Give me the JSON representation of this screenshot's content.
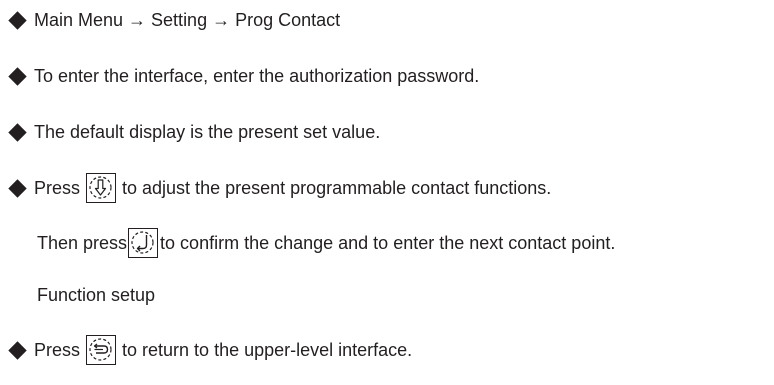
{
  "lines": {
    "nav_path": "Main Menu → Setting → Prog Contact",
    "authorization": "To enter the interface, enter the authorization password.",
    "default_display": "The default display is the present set value.",
    "press_adjust_prefix": "Press",
    "press_adjust_suffix": "to adjust the present programmable contact functions.",
    "confirm_prefix": "Then press",
    "confirm_suffix": "to confirm the change and to enter the next contact point.",
    "function_setup": "Function setup",
    "press_return_prefix": "Press",
    "press_return_suffix": "to return to the upper-level interface."
  },
  "icons": {
    "bullet": "diamond-bullet-icon",
    "adjust_key": "down-arrow-key-icon",
    "confirm_key": "enter-key-icon",
    "return_key": "return-key-icon"
  },
  "colors": {
    "text": "#231f20",
    "background": "#ffffff"
  }
}
